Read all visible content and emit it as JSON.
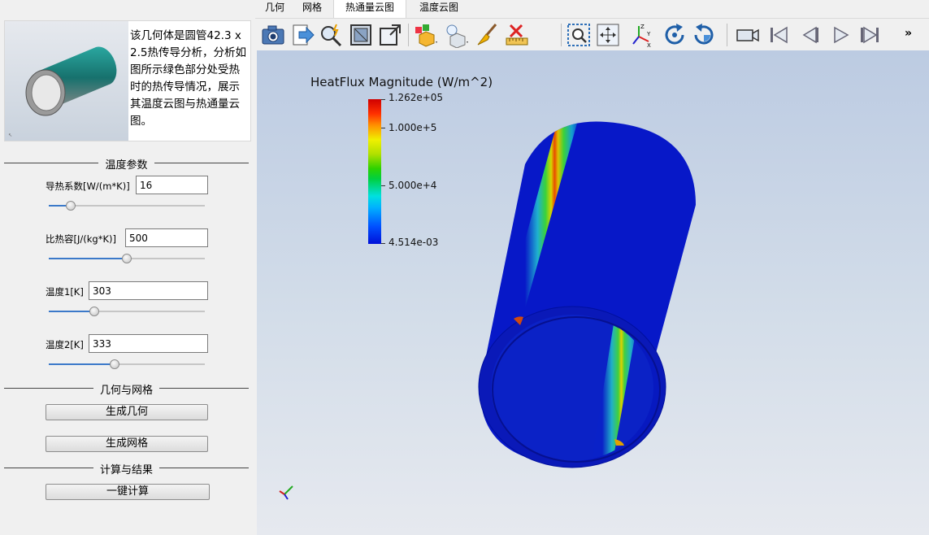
{
  "tabs": [
    "几何",
    "网格",
    "热通量云图",
    "温度云图"
  ],
  "preview": {
    "description": "该几何体是圆管42.3 x 2.5热传导分析，分析如图所示绿色部分处受热时的热传导情况，展示其温度云图与热通量云图。"
  },
  "sections": {
    "temperature": "温度参数",
    "geometry": "几何与网格",
    "compute": "计算与结果"
  },
  "params": [
    {
      "label": "导热系数[W/(m*K)]",
      "value": "16",
      "slider": 0.14
    },
    {
      "label": "比热容[J/(kg*K)]",
      "value": "500",
      "slider": 0.5
    },
    {
      "label": "温度1[K]",
      "value": "303",
      "slider": 0.29
    },
    {
      "label": "温度2[K]",
      "value": "333",
      "slider": 0.42
    }
  ],
  "buttons": {
    "gen_geometry": "生成几何",
    "gen_mesh": "生成网格",
    "compute": "一键计算"
  },
  "toolbar": {
    "icons": [
      "camera-icon",
      "export-icon",
      "magic-zoom-icon",
      "fit-view-icon",
      "restore-view-icon",
      "box-dropdown-icon",
      "light-dropdown-icon",
      "brush-icon",
      "ruler-icon",
      "zoom-box-icon",
      "pan-icon",
      "axes-icon",
      "rotate-cw-icon",
      "rotate-ccw-icon",
      "video-camera-icon",
      "first-frame-icon",
      "prev-frame-icon",
      "play-icon",
      "last-frame-icon"
    ],
    "more": "»"
  },
  "legend": {
    "title": "HeatFlux Magnitude (W/m^2)",
    "max": "1.262e+05",
    "tick1": "1.000e+5",
    "tick2": "5.000e+4",
    "min": "4.514e-03"
  },
  "colors": {
    "tube_blue": "#0718c8",
    "tube_dark": "#000f9e",
    "hot_red": "#d00000",
    "warm_green": "#2dd200"
  }
}
